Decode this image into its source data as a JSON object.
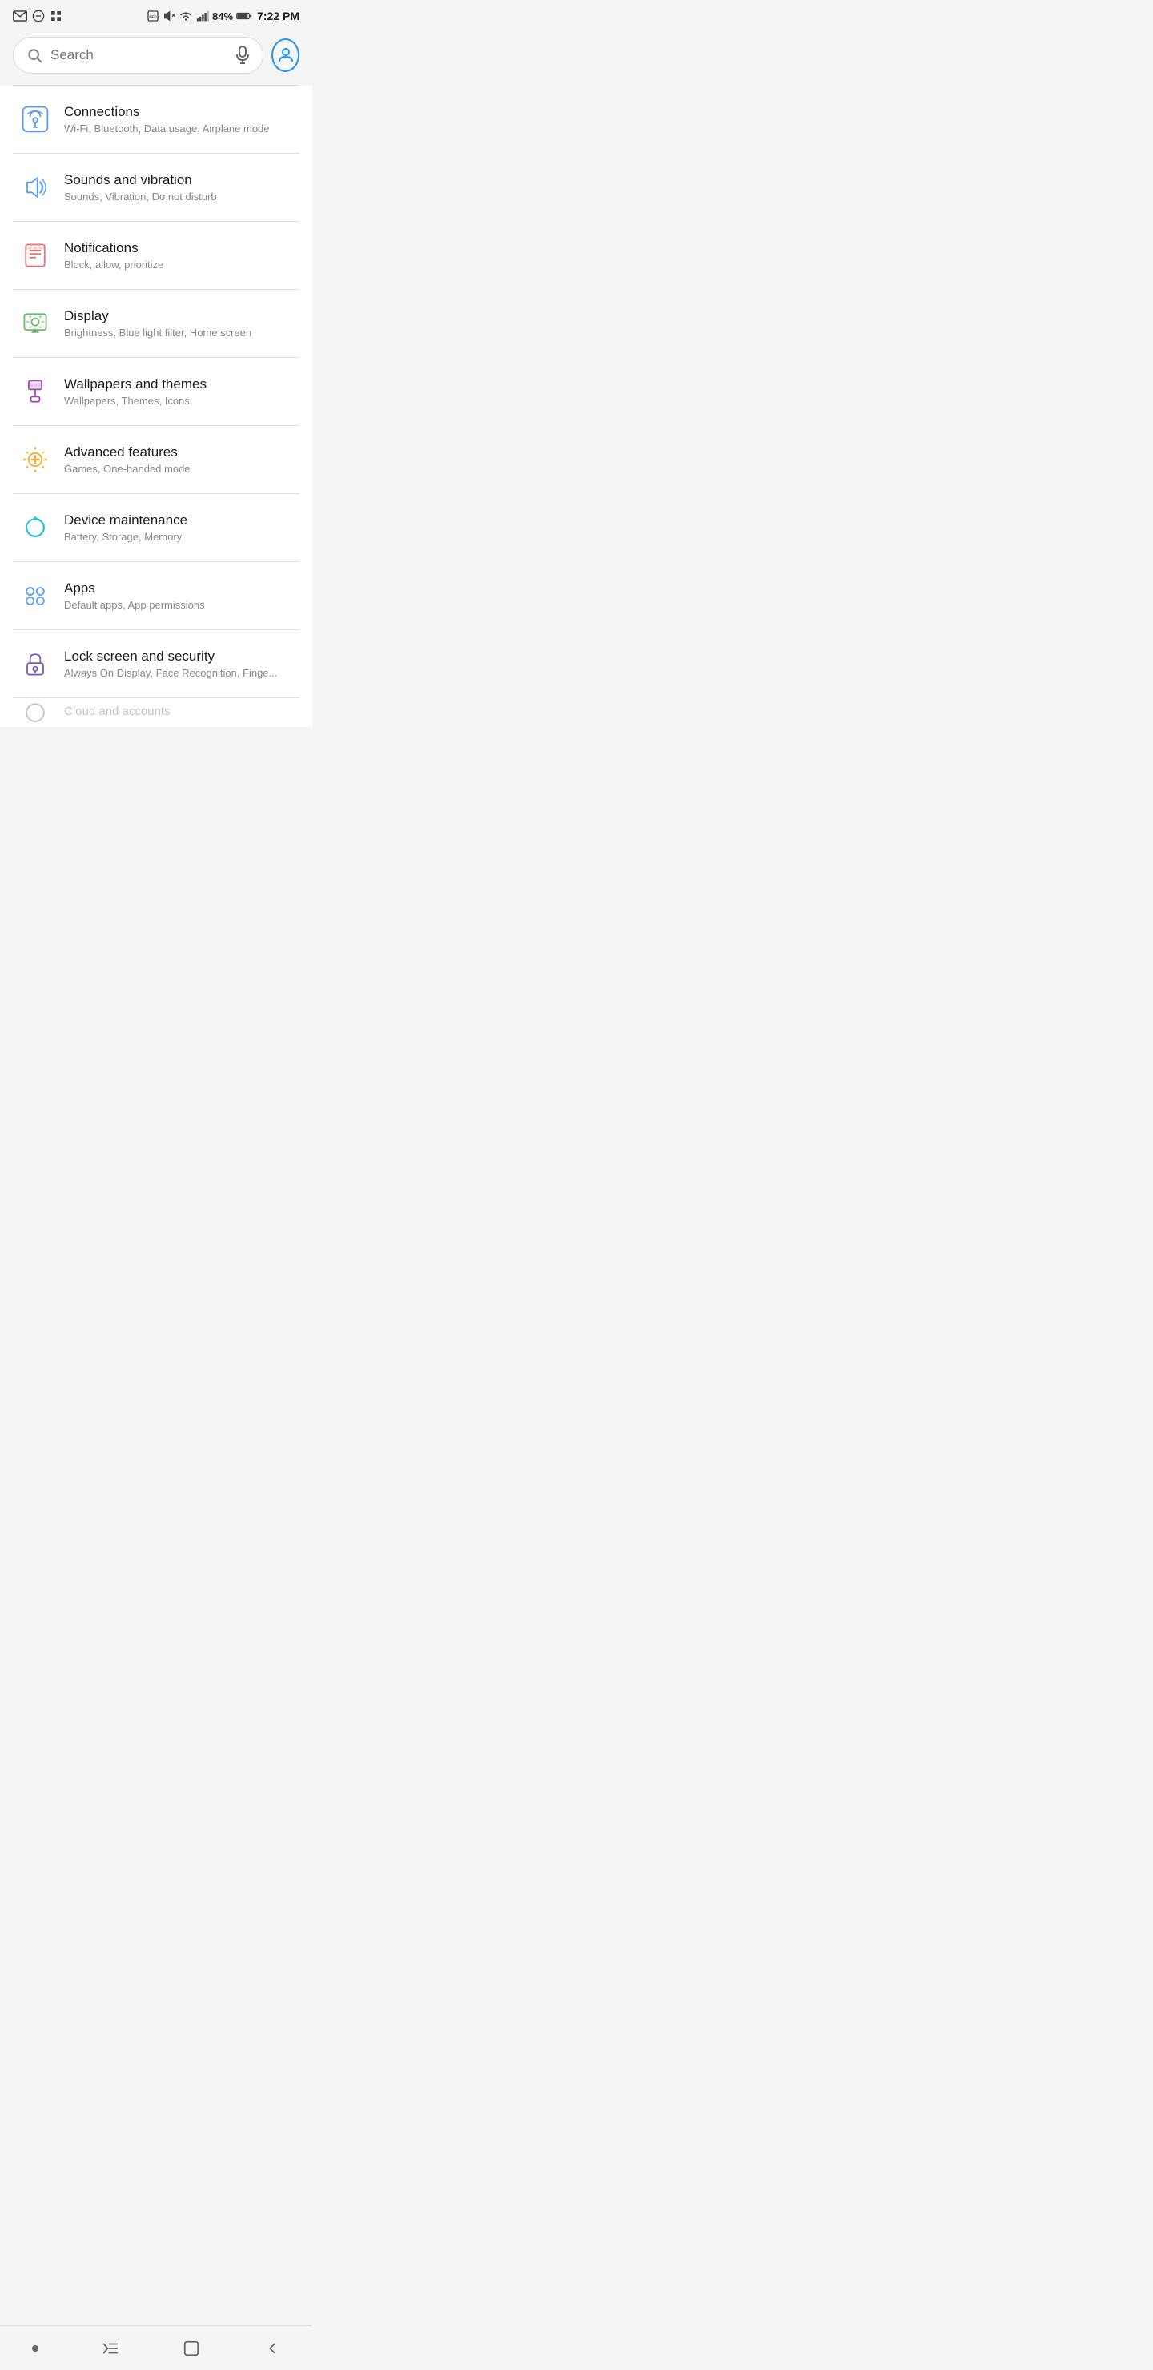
{
  "status_bar": {
    "time": "7:22 PM",
    "battery": "84%",
    "icons_left": [
      "mail",
      "minus-circle",
      "grid"
    ]
  },
  "search": {
    "placeholder": "Search",
    "mic_label": "voice-search",
    "profile_label": "profile"
  },
  "settings_items": [
    {
      "id": "connections",
      "title": "Connections",
      "subtitle": "Wi-Fi, Bluetooth, Data usage, Airplane mode",
      "icon_color": "#5c9ef5",
      "icon_type": "connections"
    },
    {
      "id": "sounds",
      "title": "Sounds and vibration",
      "subtitle": "Sounds, Vibration, Do not disturb",
      "icon_color": "#5c9ef5",
      "icon_type": "sound"
    },
    {
      "id": "notifications",
      "title": "Notifications",
      "subtitle": "Block, allow, prioritize",
      "icon_color": "#e57373",
      "icon_type": "notifications"
    },
    {
      "id": "display",
      "title": "Display",
      "subtitle": "Brightness, Blue light filter, Home screen",
      "icon_color": "#66bb6a",
      "icon_type": "display"
    },
    {
      "id": "wallpapers",
      "title": "Wallpapers and themes",
      "subtitle": "Wallpapers, Themes, Icons",
      "icon_color": "#ab47bc",
      "icon_type": "wallpapers"
    },
    {
      "id": "advanced",
      "title": "Advanced features",
      "subtitle": "Games, One-handed mode",
      "icon_color": "#ffa726",
      "icon_type": "advanced"
    },
    {
      "id": "maintenance",
      "title": "Device maintenance",
      "subtitle": "Battery, Storage, Memory",
      "icon_color": "#26c6da",
      "icon_type": "maintenance"
    },
    {
      "id": "apps",
      "title": "Apps",
      "subtitle": "Default apps, App permissions",
      "icon_color": "#5c9ef5",
      "icon_type": "apps"
    },
    {
      "id": "lockscreen",
      "title": "Lock screen and security",
      "subtitle": "Always On Display, Face Recognition, Finge...",
      "icon_color": "#7e57c2",
      "icon_type": "lock"
    }
  ],
  "bottom_nav": {
    "home_label": "home",
    "recents_label": "recents",
    "back_label": "back",
    "dot_label": "home-dot"
  }
}
